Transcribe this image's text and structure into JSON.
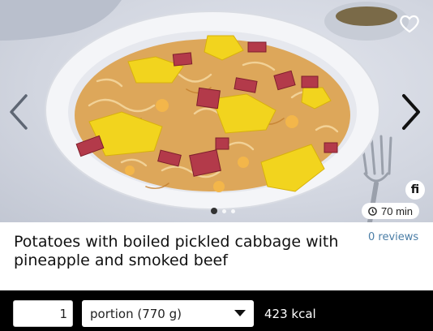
{
  "recipe": {
    "title": "Potatoes with boiled pickled cabbage with pineapple and smoked beef",
    "reviews": "0 reviews",
    "time": "70 min",
    "badge": "fi"
  },
  "carousel": {
    "slides_count": 3,
    "active_slide": 1,
    "icons": {
      "prev": "chevron-left-icon",
      "next": "chevron-right-icon",
      "favorite": "heart-icon",
      "time": "clock-icon"
    }
  },
  "nutrition_bar": {
    "quantity": "1",
    "portion_label": "portion (770 g)",
    "kcal": "423 kcal"
  },
  "colors": {
    "reviews_link": "#4a7da6",
    "bar_bg": "#000000"
  }
}
